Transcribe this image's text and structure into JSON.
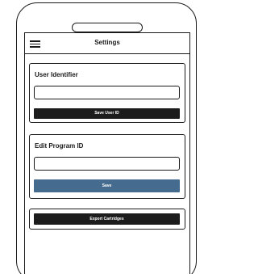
{
  "header": {
    "title": "Settings",
    "menu_icon": "hamburger-menu-icon"
  },
  "user_card": {
    "label": "User Identifier",
    "input_value": "",
    "button_label": "Save User ID"
  },
  "program_card": {
    "label": "Edit Program ID",
    "input_value": "",
    "button_label": "Save"
  },
  "export_card": {
    "button_label": "Export Cartridges"
  },
  "colors": {
    "outline": "#1a1a1a",
    "dark_button": "#1c1c1c",
    "accent_button": "#456b8e",
    "background": "#ffffff"
  }
}
